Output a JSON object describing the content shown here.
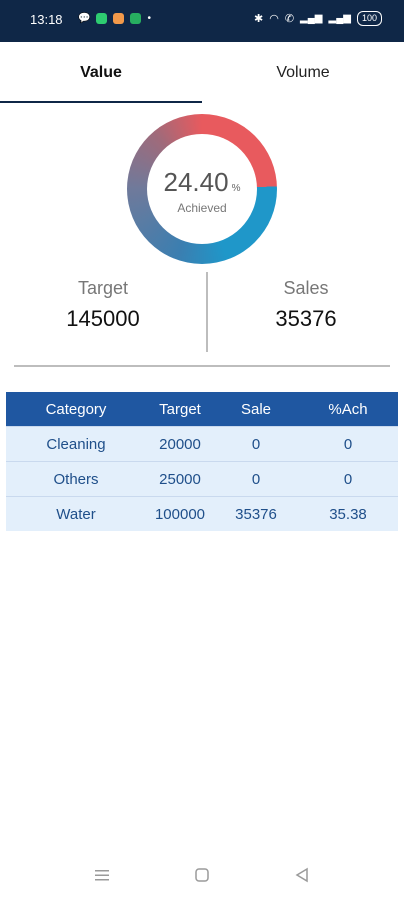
{
  "status_bar": {
    "time": "13:18",
    "battery": "100"
  },
  "tabs": [
    {
      "label": "Value",
      "active": true
    },
    {
      "label": "Volume",
      "active": false
    }
  ],
  "gauge": {
    "percent": "24.40",
    "unit": "%",
    "caption": "Achieved",
    "colors": {
      "red": "#e85a5e",
      "blue": "#1f97c9",
      "mid": "#6f7a9b"
    }
  },
  "summary": {
    "target_label": "Target",
    "target_value": "145000",
    "sales_label": "Sales",
    "sales_value": "35376"
  },
  "table": {
    "headers": [
      "Category",
      "Target",
      "Sale",
      "%Ach"
    ],
    "rows": [
      [
        "Cleaning",
        "20000",
        "0",
        "0"
      ],
      [
        "Others",
        "25000",
        "0",
        "0"
      ],
      [
        "Water",
        "100000",
        "35376",
        "35.38"
      ]
    ]
  },
  "colors": {
    "status_bar": "#0f2747",
    "table_header": "#1f57a1",
    "table_row": "#e3effb"
  }
}
